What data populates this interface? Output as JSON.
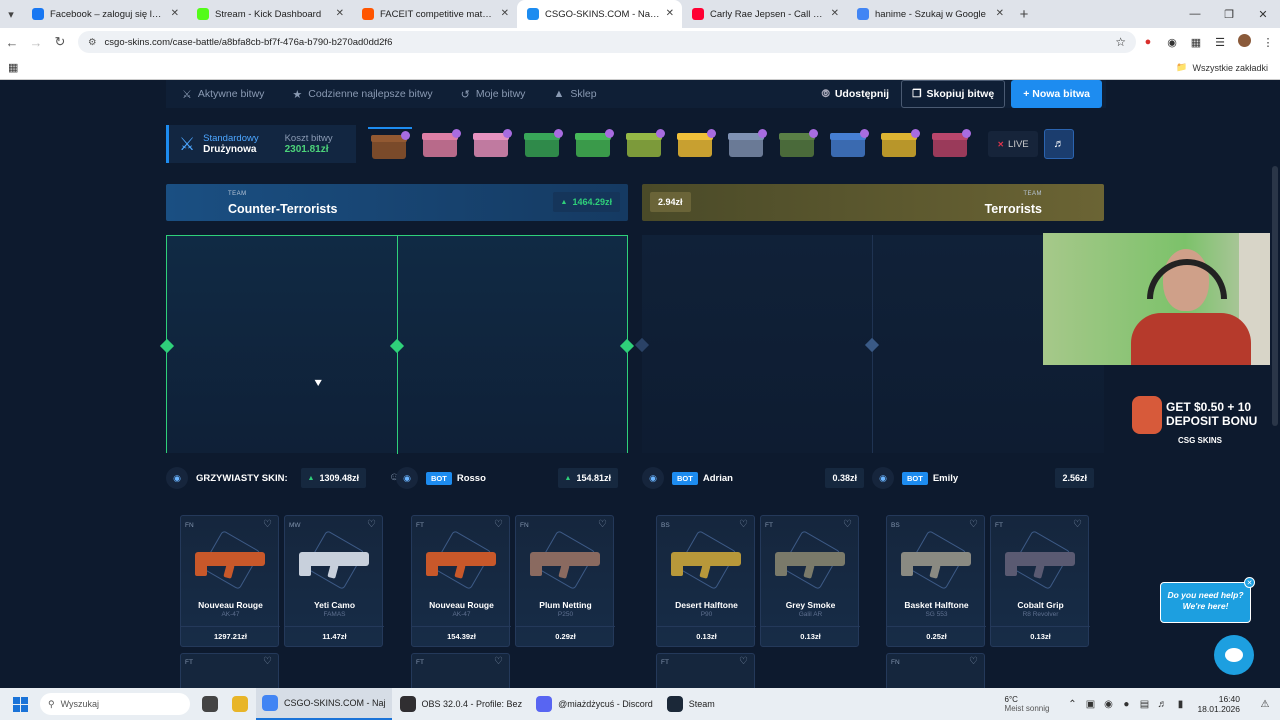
{
  "browser": {
    "tabs": [
      {
        "label": "Facebook – zaloguj się lub zarejestruj",
        "color": "#1877f2"
      },
      {
        "label": "Stream - Kick Dashboard",
        "color": "#53fc18"
      },
      {
        "label": "FACEIT competitive match - FACEIT",
        "color": "#ff5500"
      },
      {
        "label": "CSGO-SKINS.COM - Najlepsze",
        "color": "#1d8cf0",
        "active": true
      },
      {
        "label": "Carly Rae Jepsen - Call Me Maybe",
        "color": "#ff0033"
      },
      {
        "label": "hanime - Szukaj w Google",
        "color": "#4285f4"
      }
    ],
    "url": "csgo-skins.com/case-battle/a8bfa8cb-bf7f-476a-b790-b270ad0dd2f6",
    "bookmarks_label": "Wszystkie zakładki"
  },
  "site": {
    "nav": {
      "active_battles": "Aktywne bitwy",
      "daily_best": "Codzienne najlepsze bitwy",
      "my_battles": "Moje bitwy",
      "shop": "Sklep",
      "share": "Udostępnij",
      "copy": "Skopiuj bitwę",
      "new": "+ Nowa bitwa"
    },
    "battle": {
      "mode_label": "Standardowy",
      "mode_value": "Drużynowa",
      "cost_label": "Koszt bitwy",
      "cost_value": "2301.81zł",
      "live": "LIVE",
      "cases": [
        "#7a4a2a",
        "#b86a8a",
        "#c07aa0",
        "#2f8a4a",
        "#3a9a4a",
        "#7c9a3a",
        "#c8a030",
        "#6a7a96",
        "#4a6a3a",
        "#3a6ab0",
        "#b8962a",
        "#9a3a5a"
      ]
    },
    "teams": {
      "ct": {
        "sub": "TEAM",
        "name": "Counter-Terrorists",
        "value": "1464.29zł"
      },
      "t": {
        "sub": "TEAM",
        "name": "Terrorists",
        "value": "2.94zł"
      }
    },
    "players": [
      {
        "name": "GRZYWIASTY SKIN:",
        "value": "1309.48zł",
        "up": true
      },
      {
        "badge": "BOT",
        "name": "Rosso",
        "value": "154.81zł",
        "up": true
      },
      {
        "badge": "BOT",
        "name": "Adrian",
        "value": "0.38zł",
        "up": false
      },
      {
        "badge": "BOT",
        "name": "Emily",
        "value": "2.56zł",
        "up": false
      }
    ],
    "items": [
      {
        "cond": "FN",
        "name": "Nouveau Rouge",
        "weapon": "AK-47",
        "price": "1297.21zł",
        "color": "#c8582a"
      },
      {
        "cond": "MW",
        "name": "Yeti Camo",
        "weapon": "FAMAS",
        "price": "11.47zł",
        "color": "#c8d0dc"
      },
      {
        "cond": "FT",
        "name": "Nouveau Rouge",
        "weapon": "AK-47",
        "price": "154.39zł",
        "color": "#c8582a"
      },
      {
        "cond": "FN",
        "name": "Plum Netting",
        "weapon": "P250",
        "price": "0.29zł",
        "color": "#8a6a60"
      },
      {
        "cond": "BS",
        "name": "Desert Halftone",
        "weapon": "P90",
        "price": "0.13zł",
        "color": "#b8983a"
      },
      {
        "cond": "FT",
        "name": "Grey Smoke",
        "weapon": "Galil AR",
        "price": "0.13zł",
        "color": "#7a7a6a"
      },
      {
        "cond": "BS",
        "name": "Basket Halftone",
        "weapon": "SG 553",
        "price": "0.25zł",
        "color": "#8a8a82"
      },
      {
        "cond": "FT",
        "name": "Cobalt Grip",
        "weapon": "R8 Revolver",
        "price": "0.13zł",
        "color": "#5a5a72"
      }
    ],
    "second_row_conds": [
      "FT",
      "FT",
      "FT",
      "FN"
    ],
    "promo": {
      "line1": "GET $0.50 + 10",
      "line2": "DEPOSIT BONU",
      "logo": "CSG SKINS"
    },
    "help": {
      "line1": "Do you need help?",
      "line2": "We're here!"
    }
  },
  "taskbar": {
    "search": "Wyszukaj",
    "apps": [
      {
        "label": "CSGO-SKINS.COM - Naj",
        "color": "#4285f4",
        "active": true
      },
      {
        "label": "OBS 32.0.4 - Profile: Bez",
        "color": "#302e31"
      },
      {
        "label": "@miażdżycuś - Discord",
        "color": "#5865f2"
      },
      {
        "label": "Steam",
        "color": "#1b2838"
      }
    ],
    "weather_temp": "6°C",
    "weather_desc": "Meist sonnig",
    "time": "16:40",
    "date": "18.01.2026"
  }
}
